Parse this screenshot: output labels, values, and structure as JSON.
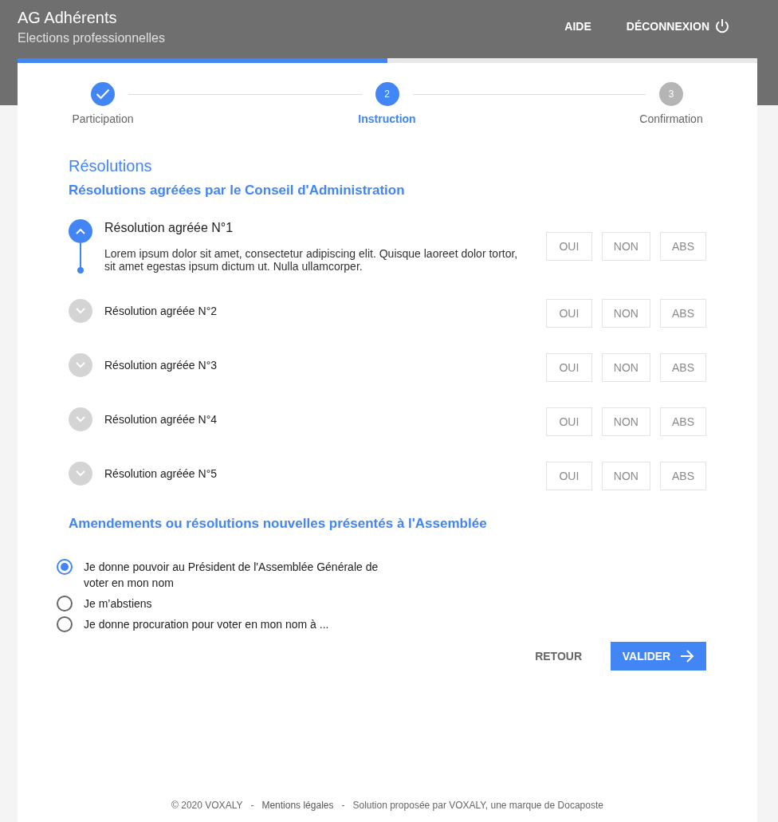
{
  "header": {
    "title": "AG Adhérents",
    "subtitle": "Elections professionnelles",
    "links": [
      {
        "label": "AIDE",
        "kind": "text"
      },
      {
        "label": "DÉCONNEXION",
        "kind": "power"
      }
    ]
  },
  "progress": {
    "level": 0.5
  },
  "steps": [
    {
      "label": "Participation",
      "completed": true,
      "selected": false
    },
    {
      "label": "Instruction",
      "number": "2",
      "completed": false,
      "selected": true
    },
    {
      "label": "Confirmation",
      "number": "3",
      "completed": false,
      "selected": false
    }
  ],
  "section_title": "Résolutions",
  "subsection_title": "Résolutions agréées par le Conseil d'Administration",
  "resolutions": [
    {
      "title": "Résolution agréée N°1",
      "expanded": true,
      "description": "Lorem ipsum dolor sit amet, consectetur adipiscing elit. Quisque laoreet dolor tortor, sit amet egestas ipsum dictum ut. Nulla ullamcorper.",
      "buttons": [
        "OUI",
        "NON",
        "ABS"
      ]
    },
    {
      "title": "Résolution agréée N°2",
      "expanded": false,
      "buttons": [
        "OUI",
        "NON",
        "ABS"
      ]
    },
    {
      "title": "Résolution agréée N°3",
      "expanded": false,
      "buttons": [
        "OUI",
        "NON",
        "ABS"
      ]
    },
    {
      "title": "Résolution agréée N°4",
      "expanded": false,
      "buttons": [
        "OUI",
        "NON",
        "ABS"
      ]
    },
    {
      "title": "Résolution agréée N°5",
      "expanded": false,
      "buttons": [
        "OUI",
        "NON",
        "ABS"
      ]
    }
  ],
  "amendments": {
    "title": "Amendements ou résolutions nouvelles présentés à l'Assemblée",
    "options": [
      {
        "label": "Je donne pouvoir au Président de l'Assemblée Générale de voter en mon nom",
        "selected": true
      },
      {
        "label": "Je m’abstiens",
        "selected": false
      },
      {
        "label": "Je donne procuration pour voter en mon nom à ...",
        "selected": false
      }
    ]
  },
  "actions": {
    "back": "RETOUR",
    "submit": "VALIDER"
  },
  "footer": [
    {
      "text": "© 2020 VOXALY",
      "kind": "text"
    },
    {
      "text": "-",
      "kind": "separator"
    },
    {
      "text": "Mentions légales",
      "kind": "link"
    },
    {
      "text": "-",
      "kind": "separator"
    },
    {
      "text": "Solution proposée par VOXALY, une marque de Docaposte",
      "kind": "text"
    }
  ]
}
